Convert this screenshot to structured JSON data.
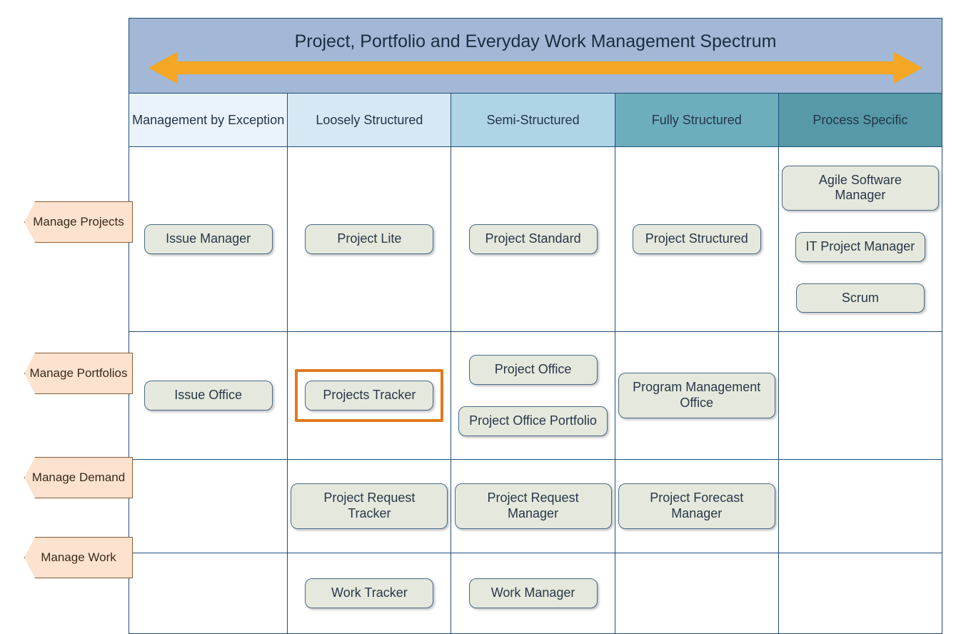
{
  "title": "Project, Portfolio and Everyday Work Management Spectrum",
  "columns": [
    "Management by Exception",
    "Loosely Structured",
    "Semi-Structured",
    "Fully Structured",
    "Process Specific"
  ],
  "rows": [
    {
      "label": "Manage Projects",
      "cells": [
        [
          "Issue Manager"
        ],
        [
          "Project Lite"
        ],
        [
          "Project Standard"
        ],
        [
          "Project Structured"
        ],
        [
          "Agile Software Manager",
          "IT Project Manager",
          "Scrum"
        ]
      ]
    },
    {
      "label": "Manage Portfolios",
      "cells": [
        [
          "Issue Office"
        ],
        [
          "Projects Tracker"
        ],
        [
          "Project Office",
          "Project Office Portfolio"
        ],
        [
          "Program Management Office"
        ],
        []
      ]
    },
    {
      "label": "Manage Demand",
      "cells": [
        [],
        [
          "Project Request Tracker"
        ],
        [
          "Project Request Manager"
        ],
        [
          "Project Forecast Manager"
        ],
        []
      ]
    },
    {
      "label": "Manage Work",
      "cells": [
        [],
        [
          "Work Tracker"
        ],
        [
          "Work Manager"
        ],
        [],
        []
      ]
    }
  ],
  "highlighted": {
    "row": 1,
    "col": 1
  },
  "arrow_color": "#f5a623",
  "rowTagTops": [
    282,
    494,
    640,
    752
  ]
}
